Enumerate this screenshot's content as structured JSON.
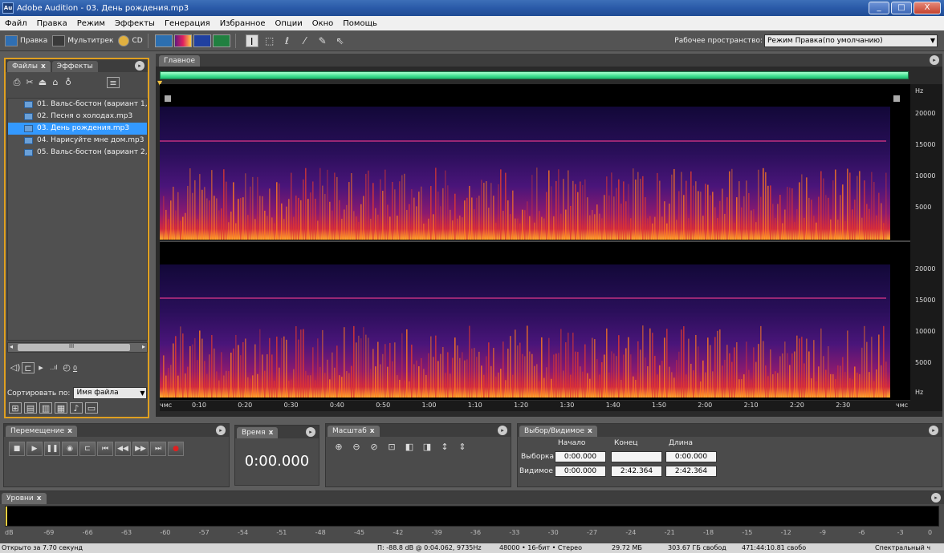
{
  "window": {
    "title": "Adobe Audition - 03. День рождения.mp3",
    "app_icon": "Au"
  },
  "menu": [
    "Файл",
    "Правка",
    "Режим",
    "Эффекты",
    "Генерация",
    "Избранное",
    "Опции",
    "Окно",
    "Помощь"
  ],
  "toolbar": {
    "edit_label": "Правка",
    "multitrack_label": "Мультитрек",
    "cd_label": "CD"
  },
  "workspace": {
    "label": "Рабочее пространство:",
    "value": "Режим Правка(по умолчанию)"
  },
  "files_panel": {
    "tabs": [
      "Файлы",
      "Эффекты"
    ],
    "files": [
      "01. Вальс-бостон (вариант 1, в",
      "02. Песня о холодах.mp3",
      "03. День рождения.mp3",
      "04. Нарисуйте мне дом.mp3",
      "05. Вальс-бостон (вариант 2, ф"
    ],
    "selected_index": 2,
    "sort_label": "Сортировать по:",
    "sort_value": "Имя файла",
    "preview_volume": "0",
    "scroll_label": "III"
  },
  "main_panel": {
    "tab": "Главное",
    "time_ruler": [
      "чмс",
      "0:10",
      "0:20",
      "0:30",
      "0:40",
      "0:50",
      "1:00",
      "1:10",
      "1:20",
      "1:30",
      "1:40",
      "1:50",
      "2:00",
      "2:10",
      "2:20",
      "2:30",
      "чмс"
    ],
    "hz_top": [
      "Hz",
      "20000",
      "15000",
      "10000",
      "5000"
    ],
    "hz_bottom": [
      "20000",
      "15000",
      "10000",
      "5000",
      "Hz"
    ]
  },
  "transport_panel": {
    "tab": "Перемещение"
  },
  "time_panel": {
    "tab": "Время",
    "display": "0:00.000"
  },
  "zoom_panel": {
    "tab": "Масштаб"
  },
  "selection_panel": {
    "tab": "Выбор/Видимое",
    "headers": [
      "Начало",
      "Конец",
      "Длина"
    ],
    "selection_label": "Выборка",
    "selection": [
      "0:00.000",
      "",
      "0:00.000"
    ],
    "view_label": "Видимое",
    "view": [
      "0:00.000",
      "2:42.364",
      "2:42.364"
    ]
  },
  "levels_panel": {
    "tab": "Уровни",
    "scale": [
      "dB",
      "-69",
      "-66",
      "-63",
      "-60",
      "-57",
      "-54",
      "-51",
      "-48",
      "-45",
      "-42",
      "-39",
      "-36",
      "-33",
      "-30",
      "-27",
      "-24",
      "-21",
      "-18",
      "-15",
      "-12",
      "-9",
      "-6",
      "-3",
      "0"
    ]
  },
  "status_bar": {
    "left": "Открыто за 7.70 секунд",
    "cursor": "П: -88.8 dB @  0:04.062, 9735Hz",
    "format": "48000 • 16-бит • Стерео",
    "size": "29.72 МБ",
    "free": "303.67 ГБ свобод",
    "free_time": "471:44:10.81 свобо",
    "view_mode": "Спектральный ч"
  },
  "colors": {
    "accent": "#3399ff",
    "selection_green": "#40e090",
    "panel_focus": "#e0a020",
    "title_bar": "#2a5aa8"
  }
}
